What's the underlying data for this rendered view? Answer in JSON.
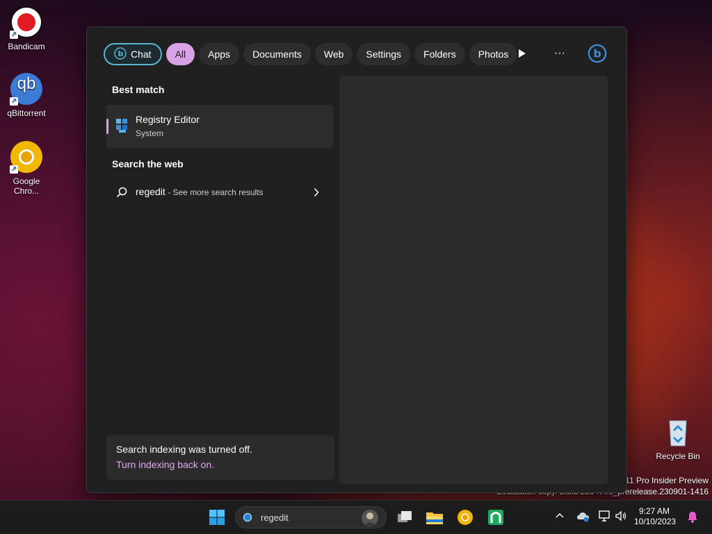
{
  "desktop": {
    "icons": [
      {
        "label": "Bandicam"
      },
      {
        "label": "qBittorrent",
        "glyph": "qb"
      },
      {
        "label": "Google Chro..."
      },
      {
        "label": "Recycle Bin"
      }
    ]
  },
  "search_panel": {
    "chat_label": "Chat",
    "filters": [
      "All",
      "Apps",
      "Documents",
      "Web",
      "Settings",
      "Folders",
      "Photos"
    ],
    "active_filter": "All",
    "more_label": "···",
    "best_match_title": "Best match",
    "best_match": {
      "title": "Registry Editor",
      "subtitle": "System"
    },
    "web_title": "Search the web",
    "web_result": {
      "query": "regedit",
      "suffix": " - See more search results"
    },
    "indexing_notice": "Search indexing was turned off.",
    "indexing_link": "Turn indexing back on."
  },
  "watermark": {
    "line1": "11 Pro Insider Preview",
    "line2": "Evaluation copy. Build 25947.rs_prerelease.230901-1416"
  },
  "taskbar": {
    "search_text": "regedit",
    "clock_time": "9:27 AM",
    "clock_date": "10/10/2023"
  },
  "colors": {
    "accent_pill": "#d9a1e6",
    "chat_border": "#59b7d0",
    "panel_bg": "#202020"
  }
}
